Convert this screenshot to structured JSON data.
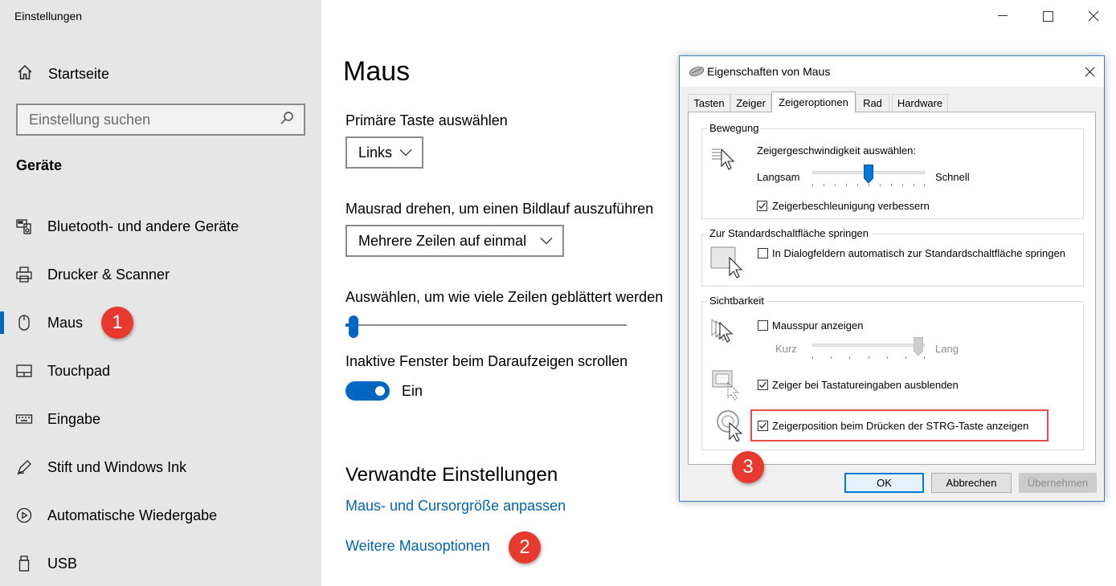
{
  "app": {
    "title": "Einstellungen"
  },
  "sidebar": {
    "home_label": "Startseite",
    "search_placeholder": "Einstellung suchen",
    "group_title": "Geräte",
    "items": [
      {
        "label": "Bluetooth- und andere Geräte",
        "icon": "bluetooth-devices-icon"
      },
      {
        "label": "Drucker & Scanner",
        "icon": "printer-icon"
      },
      {
        "label": "Maus",
        "icon": "mouse-icon",
        "active": true
      },
      {
        "label": "Touchpad",
        "icon": "touchpad-icon"
      },
      {
        "label": "Eingabe",
        "icon": "keyboard-icon"
      },
      {
        "label": "Stift und Windows Ink",
        "icon": "pen-icon"
      },
      {
        "label": "Automatische Wiedergabe",
        "icon": "autoplay-icon"
      },
      {
        "label": "USB",
        "icon": "usb-icon"
      }
    ]
  },
  "markers": {
    "m1": "1",
    "m2": "2",
    "m3": "3"
  },
  "main": {
    "title": "Maus",
    "primary_button": {
      "label": "Primäre Taste auswählen",
      "value": "Links"
    },
    "scroll_wheel": {
      "label": "Mausrad drehen, um einen Bildlauf auszuführen",
      "value": "Mehrere Zeilen auf einmal"
    },
    "lines_slider": {
      "label": "Auswählen, um wie viele Zeilen geblättert werden",
      "value_fraction": 0.03
    },
    "inactive_scroll": {
      "label": "Inaktive Fenster beim Daraufzeigen scrollen",
      "state": "Ein"
    },
    "related": {
      "title": "Verwandte Einstellungen",
      "link1": "Maus- und Cursorgröße anpassen",
      "link2": "Weitere Mausoptionen"
    }
  },
  "dialog": {
    "title": "Eigenschaften von Maus",
    "tabs": [
      "Tasten",
      "Zeiger",
      "Zeigeroptionen",
      "Rad",
      "Hardware"
    ],
    "active_tab": "Zeigeroptionen",
    "motion": {
      "legend": "Bewegung",
      "speed_label": "Zeigergeschwindigkeit auswählen:",
      "slow": "Langsam",
      "fast": "Schnell",
      "speed_fraction": 0.5,
      "enhance_label": "Zeigerbeschleunigung verbessern",
      "enhance_checked": true
    },
    "snap_to": {
      "legend": "Zur Standardschaltfläche springen",
      "label": "In Dialogfeldern automatisch zur Standardschaltfläche springen",
      "checked": false
    },
    "visibility": {
      "legend": "Sichtbarkeit",
      "trails_label": "Mausspur anzeigen",
      "trails_checked": false,
      "short": "Kurz",
      "long": "Lang",
      "trails_fraction": 1.0,
      "hide_label": "Zeiger bei Tastatureingaben ausblenden",
      "hide_checked": true,
      "ctrl_label": "Zeigerposition beim Drücken der STRG-Taste anzeigen",
      "ctrl_checked": true
    },
    "buttons": {
      "ok": "OK",
      "cancel": "Abbrechen",
      "apply": "Übernehmen"
    }
  },
  "colors": {
    "accent": "#0067c0",
    "link": "#0063b1",
    "marker": "#e8392f",
    "highlight": "#e64b44"
  }
}
